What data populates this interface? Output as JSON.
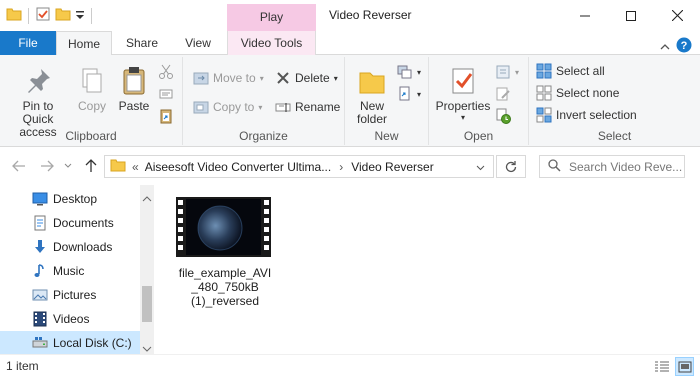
{
  "titlebar": {
    "context_tab_label": "Play",
    "window_title": "Video Reverser",
    "icons": [
      "folder-icon",
      "properties-check-icon",
      "new-folder-icon",
      "customize-qat-icon"
    ],
    "buttons": [
      "minimize",
      "maximize",
      "close"
    ]
  },
  "tabs": {
    "file": "File",
    "home": "Home",
    "share": "Share",
    "view": "View",
    "video_tools": "Video Tools"
  },
  "ribbon": {
    "clipboard": {
      "label": "Clipboard",
      "pin": "Pin to Quick access",
      "copy": "Copy",
      "paste": "Paste"
    },
    "organize": {
      "label": "Organize",
      "move_to": "Move to",
      "copy_to": "Copy to",
      "delete": "Delete",
      "rename": "Rename"
    },
    "new": {
      "label": "New",
      "new_folder": "New folder"
    },
    "open": {
      "label": "Open",
      "properties": "Properties"
    },
    "select": {
      "label": "Select",
      "select_all": "Select all",
      "select_none": "Select none",
      "invert_selection": "Invert selection"
    }
  },
  "addressbar": {
    "path_root": "Aiseesoft Video Converter Ultima...",
    "path_current": "Video Reverser",
    "search_placeholder": "Search Video Reve..."
  },
  "navpane": {
    "items": [
      {
        "label": "Desktop",
        "icon": "desktop-icon"
      },
      {
        "label": "Documents",
        "icon": "documents-icon"
      },
      {
        "label": "Downloads",
        "icon": "downloads-icon"
      },
      {
        "label": "Music",
        "icon": "music-icon"
      },
      {
        "label": "Pictures",
        "icon": "pictures-icon"
      },
      {
        "label": "Videos",
        "icon": "videos-icon"
      },
      {
        "label": "Local Disk (C:)",
        "icon": "drive-icon"
      }
    ]
  },
  "content": {
    "file": {
      "name": "file_example_AVI_480_750kB (1)_reversed",
      "name_lines": [
        "file_example_AVI",
        "_480_750kB",
        "(1)_reversed"
      ]
    }
  },
  "statusbar": {
    "item_count": "1 item"
  },
  "colors": {
    "file_tab": "#1979ca",
    "play_context": "#f6c9e4",
    "selection": "#cce8ff"
  }
}
